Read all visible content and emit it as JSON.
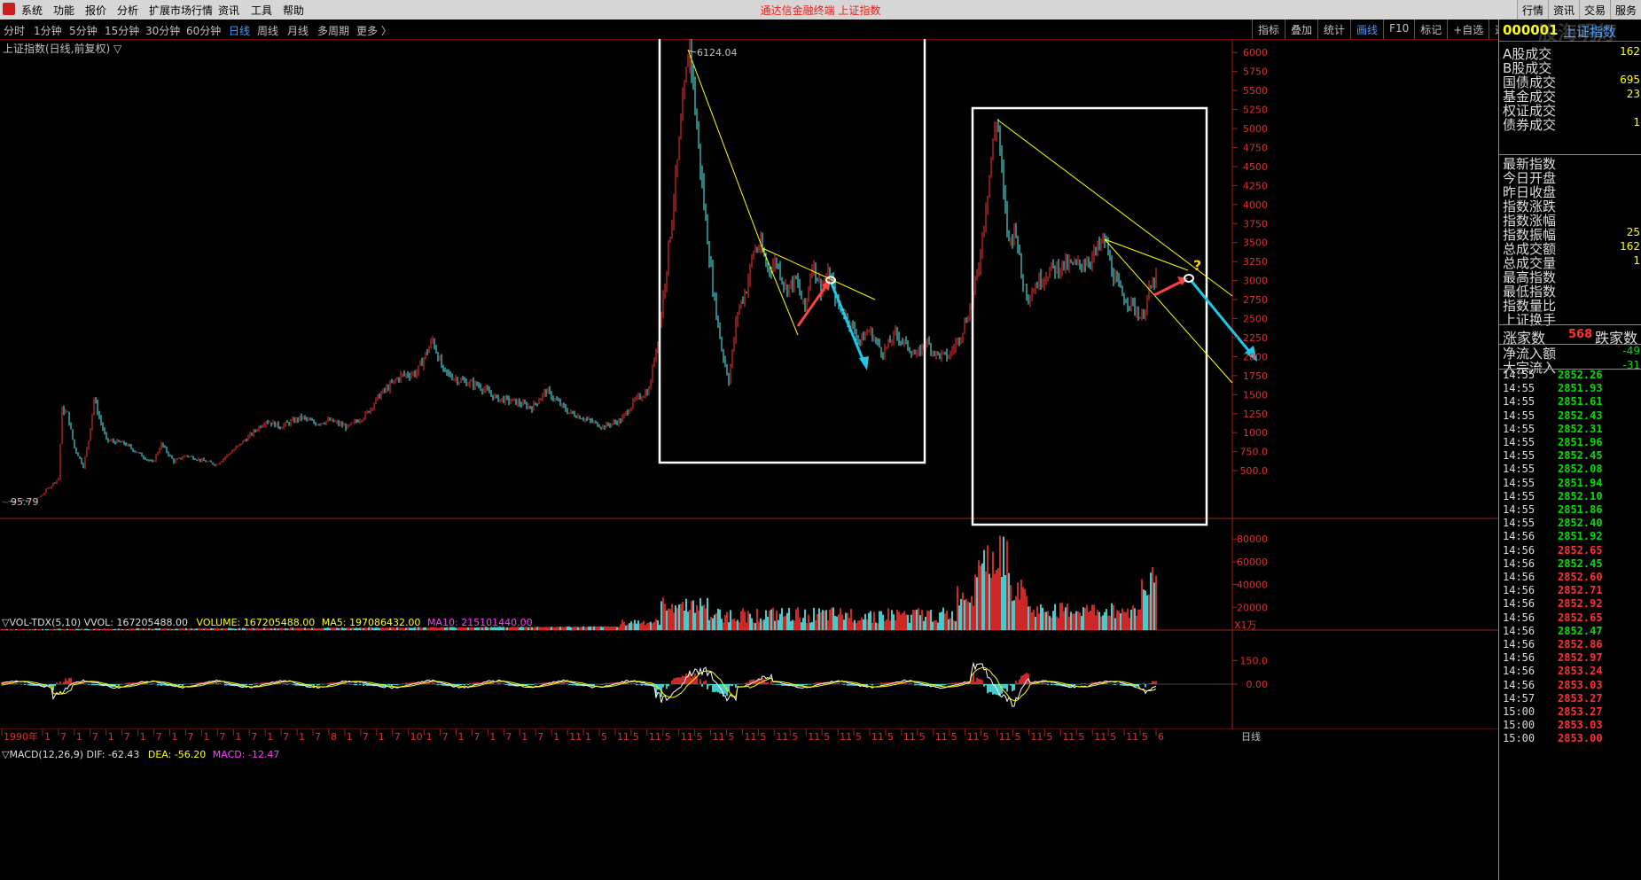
{
  "menubar": {
    "items": [
      "系统",
      "功能",
      "报价",
      "分析",
      "扩展市场行情",
      "资讯",
      "工具",
      "帮助"
    ],
    "app_title": "通达信金融终端 上证指数",
    "right_buttons": [
      "行情",
      "资讯",
      "交易",
      "服务"
    ]
  },
  "periodbar": {
    "items": [
      "分时",
      "1分钟",
      "5分钟",
      "15分钟",
      "30分钟",
      "60分钟",
      "日线",
      "周线",
      "月线",
      "多周期",
      "更多 〉"
    ],
    "active": "日线"
  },
  "toolbar": {
    "items": [
      "指标",
      "叠加",
      "统计",
      "画线",
      "F10",
      "标记",
      "+自选",
      "返回"
    ],
    "active": "画线"
  },
  "chart_header": {
    "title": "上证指数(日线,前复权) ▽"
  },
  "panel": {
    "code": "000001",
    "name": "上证指数",
    "watermark": "股海明灯",
    "rows": [
      {
        "label": "A股成交",
        "value": "162"
      },
      {
        "label": "B股成交",
        "value": ""
      },
      {
        "label": "国债成交",
        "value": "695"
      },
      {
        "label": "基金成交",
        "value": "23"
      },
      {
        "label": "权证成交",
        "value": ""
      },
      {
        "label": "债券成交",
        "value": "1"
      }
    ],
    "rows2": [
      {
        "label": "最新指数",
        "value": ""
      },
      {
        "label": "今日开盘",
        "value": ""
      },
      {
        "label": "昨日收盘",
        "value": ""
      },
      {
        "label": "指数涨跌",
        "value": ""
      },
      {
        "label": "指数涨幅",
        "value": ""
      },
      {
        "label": "指数振幅",
        "value": "25"
      },
      {
        "label": "总成交额",
        "value": "162"
      },
      {
        "label": "总成交量",
        "value": "1"
      },
      {
        "label": "最高指数",
        "value": ""
      },
      {
        "label": "最低指数",
        "value": ""
      },
      {
        "label": "指数量比",
        "value": ""
      },
      {
        "label": "上证换手",
        "value": ""
      }
    ],
    "updown": {
      "label": "涨家数",
      "value": "568",
      "label2": "跌家数"
    },
    "flow": [
      {
        "label": "净流入额",
        "value": "-49"
      },
      {
        "label": "大宗流入",
        "value": "-31"
      }
    ],
    "ticks": [
      {
        "t": "14:55",
        "p": "2852.26",
        "c": "#00e000"
      },
      {
        "t": "14:55",
        "p": "2851.93",
        "c": "#00e000"
      },
      {
        "t": "14:55",
        "p": "2851.61",
        "c": "#00e000"
      },
      {
        "t": "14:55",
        "p": "2852.43",
        "c": "#00e000"
      },
      {
        "t": "14:55",
        "p": "2852.31",
        "c": "#00e000"
      },
      {
        "t": "14:55",
        "p": "2851.96",
        "c": "#00e000"
      },
      {
        "t": "14:55",
        "p": "2852.45",
        "c": "#00e000"
      },
      {
        "t": "14:55",
        "p": "2852.08",
        "c": "#00e000"
      },
      {
        "t": "14:55",
        "p": "2851.94",
        "c": "#00e000"
      },
      {
        "t": "14:55",
        "p": "2852.10",
        "c": "#00e000"
      },
      {
        "t": "14:55",
        "p": "2851.86",
        "c": "#00e000"
      },
      {
        "t": "14:55",
        "p": "2852.40",
        "c": "#00e000"
      },
      {
        "t": "14:56",
        "p": "2851.92",
        "c": "#00e000"
      },
      {
        "t": "14:56",
        "p": "2852.65",
        "c": "#ff3030"
      },
      {
        "t": "14:56",
        "p": "2852.45",
        "c": "#00e000"
      },
      {
        "t": "14:56",
        "p": "2852.60",
        "c": "#ff3030"
      },
      {
        "t": "14:56",
        "p": "2852.71",
        "c": "#ff3030"
      },
      {
        "t": "14:56",
        "p": "2852.92",
        "c": "#ff3030"
      },
      {
        "t": "14:56",
        "p": "2852.65",
        "c": "#ff3030"
      },
      {
        "t": "14:56",
        "p": "2852.47",
        "c": "#00e000"
      },
      {
        "t": "14:56",
        "p": "2852.86",
        "c": "#ff3030"
      },
      {
        "t": "14:56",
        "p": "2852.97",
        "c": "#ff3030"
      },
      {
        "t": "14:56",
        "p": "2853.24",
        "c": "#ff3030"
      },
      {
        "t": "14:56",
        "p": "2853.03",
        "c": "#ff3030"
      },
      {
        "t": "14:57",
        "p": "2853.27",
        "c": "#ff3030"
      },
      {
        "t": "15:00",
        "p": "2853.27",
        "c": "#ff3030"
      },
      {
        "t": "15:00",
        "p": "2853.03",
        "c": "#ff3030"
      },
      {
        "t": "15:00",
        "p": "2853.00",
        "c": "#ff3030"
      }
    ]
  },
  "price_chart": {
    "y_ticks": [
      "6000",
      "5750",
      "5500",
      "5250",
      "5000",
      "4750",
      "4500",
      "4250",
      "4000",
      "3750",
      "3500",
      "3250",
      "3000",
      "2750",
      "2500",
      "2250",
      "2000",
      "1750",
      "1500",
      "1250",
      "1000",
      "750.0",
      "500.0"
    ],
    "peak_label": "6124.04",
    "low_label": "95.79",
    "question": "?"
  },
  "volume_chart": {
    "label": "▽VOL-TDX(5,10)",
    "vvol": "VVOL: 167205488.00",
    "volume": "VOLUME: 167205488.00",
    "ma5": "MA5: 197086432.00",
    "ma10": "MA10: 215101440.00",
    "y_ticks": [
      "80000",
      "60000",
      "40000",
      "20000"
    ],
    "unit": "X1万"
  },
  "macd_chart": {
    "label": "▽MACD(12,26,9)",
    "dif": "DIF: -62.43",
    "dea": "DEA: -56.20",
    "macd": "MACD: -12.47",
    "y_ticks": [
      "150.0",
      "0.00"
    ]
  },
  "x_axis": {
    "labels": [
      "1990年",
      "1",
      "7",
      "1",
      "7",
      "1",
      "7",
      "1",
      "7",
      "1",
      "7",
      "1",
      "7",
      "1",
      "7",
      "1",
      "7",
      "1",
      "7",
      "8",
      "1",
      "7",
      "1",
      "7",
      "10",
      "1",
      "7",
      "1",
      "7",
      "1",
      "7",
      "1",
      "7",
      "1",
      "11",
      "1",
      "5",
      "11",
      "5",
      "11",
      "5",
      "11",
      "5",
      "11",
      "5",
      "11",
      "5",
      "11",
      "5",
      "11",
      "5",
      "11",
      "5",
      "11",
      "5",
      "11",
      "5",
      "11",
      "5",
      "11",
      "5",
      "11",
      "5",
      "11",
      "5",
      "11",
      "5",
      "11",
      "5",
      "11",
      "5",
      "6"
    ],
    "period": "日线"
  },
  "colors": {
    "up": "#ff3333",
    "down": "#54ffff",
    "trend": "#ffff00",
    "dif": "#ffffff",
    "dea": "#ffff00",
    "arrow_up": "#ff4040",
    "arrow_down": "#20c8e8"
  }
}
